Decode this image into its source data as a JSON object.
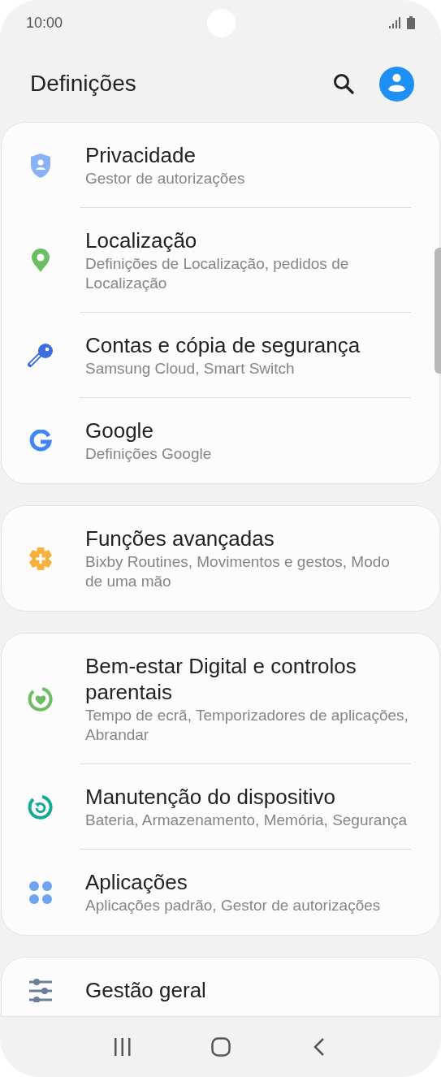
{
  "status_bar": {
    "time": "10:00"
  },
  "header": {
    "title": "Definições"
  },
  "groups": [
    {
      "items": [
        {
          "title": "Privacidade",
          "subtitle": "Gestor de autorizações"
        },
        {
          "title": "Localização",
          "subtitle": "Definições de Localização, pedidos de Localização"
        },
        {
          "title": "Contas e cópia de segurança",
          "subtitle": "Samsung Cloud, Smart Switch"
        },
        {
          "title": "Google",
          "subtitle": "Definições Google"
        }
      ]
    },
    {
      "items": [
        {
          "title": "Funções avançadas",
          "subtitle": "Bixby Routines, Movimentos e gestos, Modo de uma mão"
        }
      ]
    },
    {
      "items": [
        {
          "title": "Bem-estar Digital e controlos parentais",
          "subtitle": "Tempo de ecrã, Temporizadores de aplicações, Abrandar"
        },
        {
          "title": "Manutenção do dispositivo",
          "subtitle": "Bateria, Armazenamento, Memória, Segurança"
        },
        {
          "title": "Aplicações",
          "subtitle": "Aplicações padrão, Gestor de autorizações"
        }
      ]
    },
    {
      "items": [
        {
          "title": "Gestão geral"
        }
      ]
    }
  ]
}
